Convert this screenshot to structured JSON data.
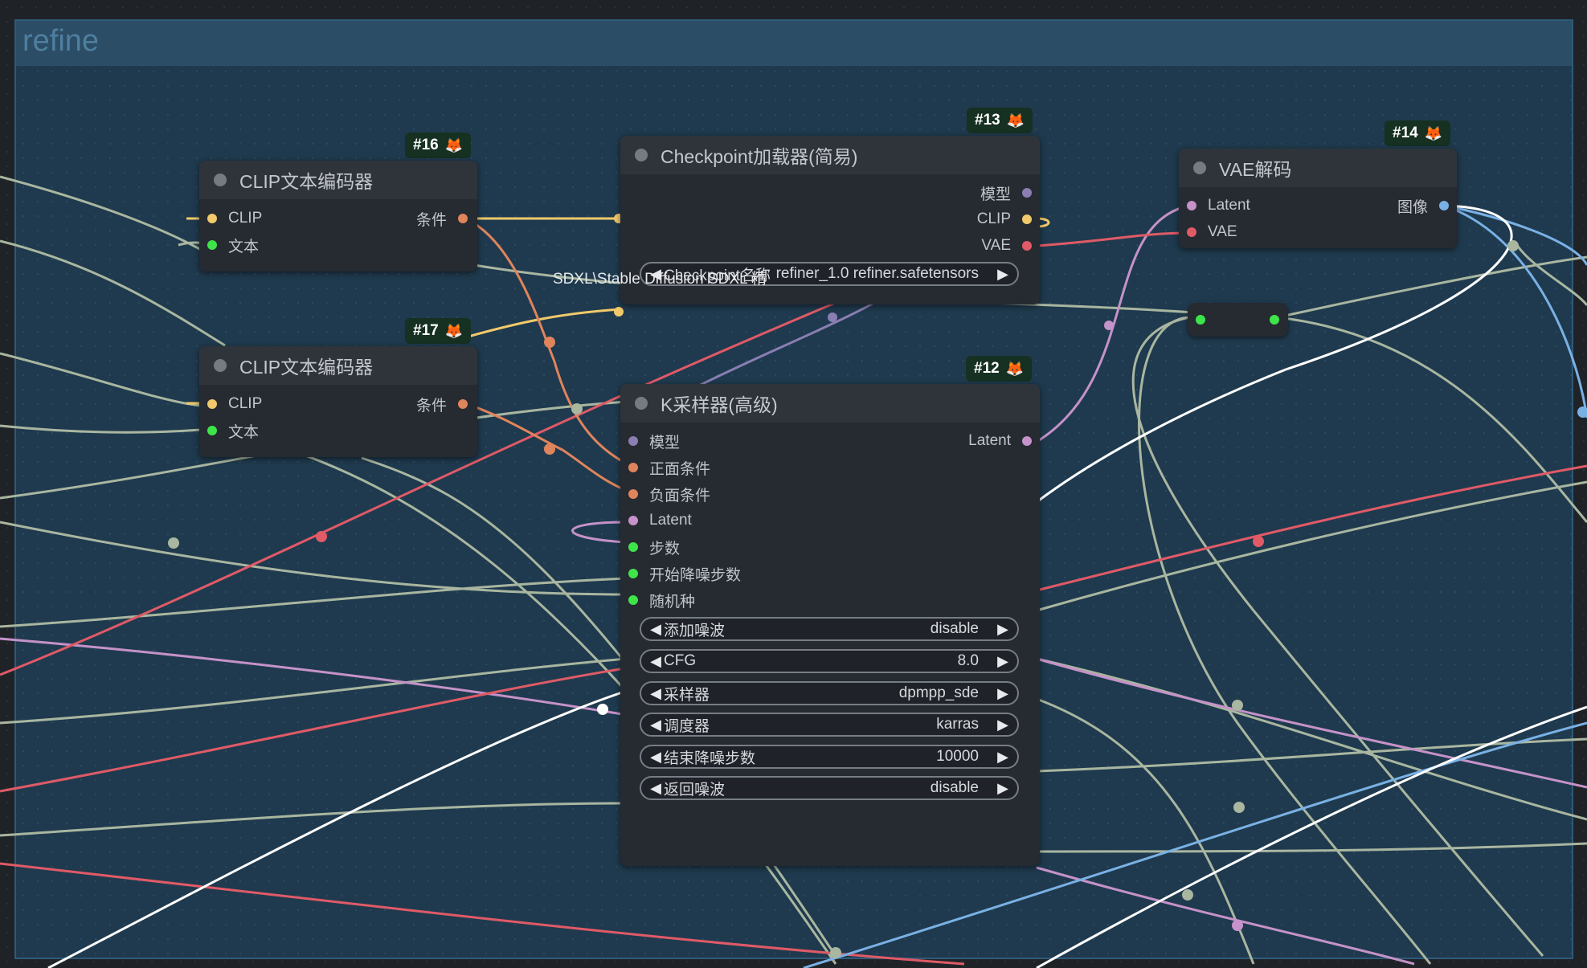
{
  "group": {
    "title": "refine"
  },
  "nodes": {
    "clip16": {
      "badge": "#16",
      "title": "CLIP文本编码器",
      "inputs": [
        "CLIP",
        "文本"
      ],
      "output": "条件"
    },
    "clip17": {
      "badge": "#17",
      "title": "CLIP文本编码器",
      "inputs": [
        "CLIP",
        "文本"
      ],
      "output": "条件"
    },
    "ckpt13": {
      "badge": "#13",
      "title": "Checkpoint加载器(简易)",
      "outputs": [
        "模型",
        "CLIP",
        "VAE"
      ],
      "widget_label": "SDXL\\Stable Diffusion SDXL 精",
      "widget_overlap": "Checkpoint名称",
      "widget_value": "refiner_1.0 refiner.safetensors"
    },
    "vae14": {
      "badge": "#14",
      "title": "VAE解码",
      "inputs": [
        "Latent",
        "VAE"
      ],
      "output": "图像"
    },
    "ksampler12": {
      "badge": "#12",
      "title": "K采样器(高级)",
      "inputs": [
        "模型",
        "正面条件",
        "负面条件",
        "Latent",
        "步数",
        "开始降噪步数",
        "随机种"
      ],
      "output": "Latent",
      "widgets": [
        {
          "label": "添加噪波",
          "value": "disable"
        },
        {
          "label": "CFG",
          "value": "8.0"
        },
        {
          "label": "采样器",
          "value": "dpmpp_sde"
        },
        {
          "label": "调度器",
          "value": "karras"
        },
        {
          "label": "结束降噪步数",
          "value": "10000"
        },
        {
          "label": "返回噪波",
          "value": "disable"
        }
      ]
    }
  },
  "colors": {
    "clip": "#f2c96b",
    "conditioning": "#e0845c",
    "model": "#8a7eb3",
    "vae": "#e05a67",
    "latent": "#c592c9",
    "int": "#3de44a",
    "image": "#7ab1e5",
    "wire_gray": "#a9b6a0",
    "wire_white": "#ffffff"
  },
  "icons": {
    "badge_icon": "fox-icon"
  }
}
